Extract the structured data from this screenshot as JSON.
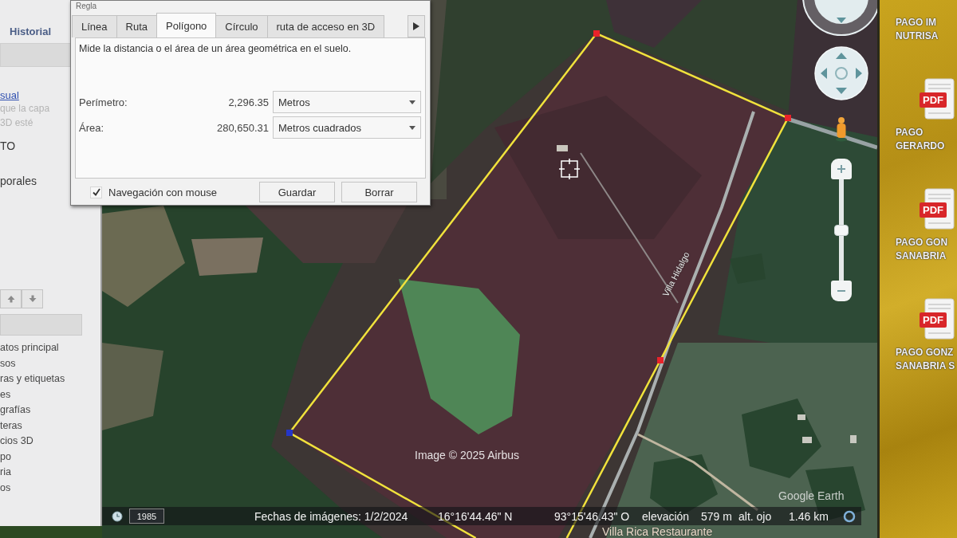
{
  "sidebar": {
    "tab": "Historial",
    "link": "sual",
    "hint_lines": [
      "que la capa",
      "3D esté"
    ],
    "entries": [
      "TO",
      "porales"
    ],
    "layers": [
      "atos principal",
      "sos",
      "ras y etiquetas",
      "es",
      "grafías",
      "teras",
      "cios 3D",
      "po",
      "ria",
      "os"
    ]
  },
  "measure_dialog": {
    "title": "Regla",
    "tabs": [
      {
        "label": "Línea",
        "selected": false
      },
      {
        "label": "Ruta",
        "selected": false
      },
      {
        "label": "Polígono",
        "selected": true
      },
      {
        "label": "Círculo",
        "selected": false
      },
      {
        "label": "ruta de acceso en 3D",
        "selected": false
      }
    ],
    "description": "Mide la distancia o el área de un área geométrica en el suelo.",
    "measurements": [
      {
        "label": "Perímetro:",
        "value": "2,296.35",
        "unit": "Metros"
      },
      {
        "label": "Área:",
        "value": "280,650.31",
        "unit": "Metros cuadrados"
      }
    ],
    "mouse_navigation": {
      "label": "Navegación con mouse",
      "checked": true
    },
    "buttons": [
      "Guardar",
      "Borrar"
    ]
  },
  "map": {
    "polygon": {
      "vertices": [
        {
          "color": "#e8232a"
        },
        {
          "color": "#e8232a"
        },
        {
          "color": "#e8232a"
        },
        {
          "color": "#2436c8"
        }
      ]
    },
    "road_label": "Villa Hidalgo",
    "attribution": "Image © 2025 Airbus",
    "logo": "Google Earth",
    "place_label": "Villa Rica Restaurante",
    "zoom_slider": {
      "level": 0.5
    }
  },
  "status_bar": {
    "historical_year": "1985",
    "imagery_date": "Fechas de imágenes: 1/2/2024",
    "latitude": "16°16'44.46\" N",
    "longitude": "93°15'46.43\" O",
    "elevation_label": "elevación",
    "elevation": "579 m",
    "eye_altitude_label": "alt. ojo",
    "eye_altitude": "1.46 km"
  },
  "desktop": {
    "files": [
      {
        "lines": [
          "PAGO IM",
          "NUTRISA"
        ]
      },
      {
        "badge": "PDF",
        "lines": [
          "PAGO",
          "GERARDO"
        ]
      },
      {
        "badge": "PDF",
        "lines": [
          "PAGO GON",
          "SANABRIA"
        ]
      },
      {
        "badge": "PDF",
        "lines": [
          "PAGO GONZ",
          "SANABRIA S"
        ]
      }
    ]
  }
}
